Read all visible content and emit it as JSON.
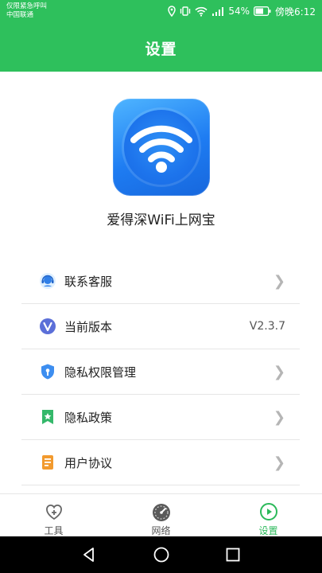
{
  "status_bar": {
    "carrier_line1": "仅限紧急呼叫",
    "carrier_line2": "中国联通",
    "battery": "54%",
    "time": "傍晚6:12",
    "icons": [
      "location-icon",
      "vibrate-icon",
      "wifi-icon",
      "signal-icon",
      "battery-icon"
    ]
  },
  "header": {
    "title": "设置"
  },
  "app": {
    "name": "爱得深WiFi上网宝",
    "logo_icon": "wifi-icon"
  },
  "settings": {
    "items": [
      {
        "label": "联系客服",
        "icon": "customer-service-icon",
        "value": ""
      },
      {
        "label": "当前版本",
        "icon": "version-icon",
        "value": "V2.3.7"
      },
      {
        "label": "隐私权限管理",
        "icon": "shield-icon",
        "value": ""
      },
      {
        "label": "隐私政策",
        "icon": "bookmark-star-icon",
        "value": ""
      },
      {
        "label": "用户协议",
        "icon": "document-icon",
        "value": ""
      }
    ]
  },
  "tabbar": {
    "tabs": [
      {
        "label": "工具",
        "icon": "heart-plus-icon",
        "active": false
      },
      {
        "label": "网络",
        "icon": "speedometer-icon",
        "active": false
      },
      {
        "label": "设置",
        "icon": "play-circle-icon",
        "active": true
      }
    ]
  },
  "colors": {
    "brand_green": "#2ec05c",
    "active_tab": "#2bb95a",
    "logo_blue": "#1e7cf2"
  }
}
